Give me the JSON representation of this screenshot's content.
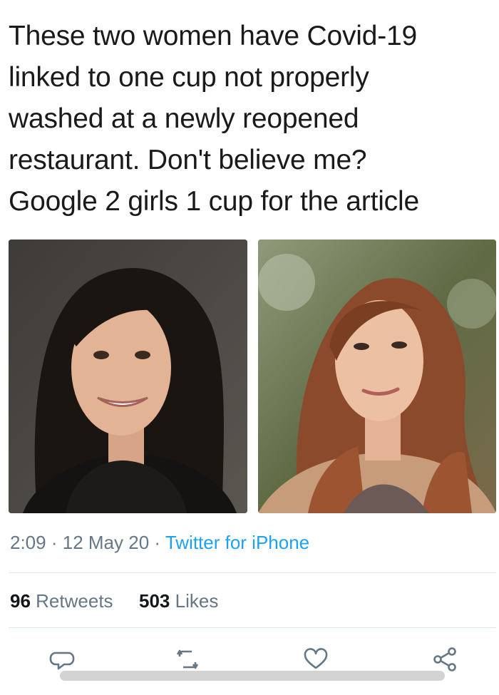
{
  "tweet": {
    "text_lines": [
      "These two women have Covid-19",
      "linked to one cup not properly",
      "washed at a newly reopened",
      "restaurant. Don't believe me?",
      "Google 2 girls 1 cup for the article"
    ],
    "time": "2:09",
    "date": "12 May 20",
    "separator": "·",
    "source": "Twitter for iPhone"
  },
  "stats": {
    "retweets_count": "96",
    "retweets_label": "Retweets",
    "likes_count": "503",
    "likes_label": "Likes"
  },
  "actions": {
    "reply_icon": "reply-icon",
    "retweet_icon": "retweet-icon",
    "like_icon": "heart-icon",
    "share_icon": "share-icon"
  },
  "colors": {
    "link": "#1da1f2",
    "secondary_text": "#657786",
    "primary_text": "#14171a"
  }
}
